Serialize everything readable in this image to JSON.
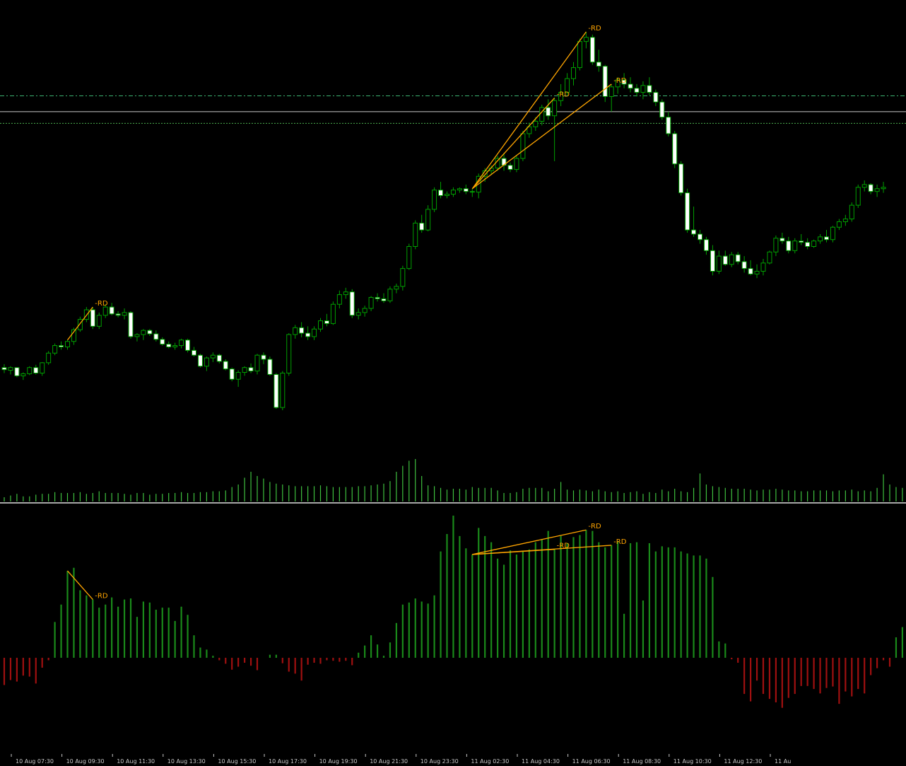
{
  "colors": {
    "background": "#000000",
    "candle_wick": "#00A000",
    "bull_body": "#000000",
    "bear_body": "#FFFFFF",
    "volume": "#3FC03F",
    "hist_positive": "#1A8A1A",
    "hist_negative": "#A01010",
    "divergence": "#FFA500",
    "level_dashdot": "#3CB371",
    "level_dotted": "#4CAF50",
    "level_solid": "#C8C8C8",
    "separator": "#E0E0E0"
  },
  "divergence_label": "-RD",
  "chart_data": [
    {
      "type": "candlestick",
      "description_panel": "price",
      "candles": [
        [
          1.0,
          1.05,
          0.92,
          0.97
        ],
        [
          0.96,
          1.02,
          0.9,
          1.0
        ],
        [
          1.0,
          1.0,
          0.86,
          0.88
        ],
        [
          0.88,
          0.93,
          0.82,
          0.91
        ],
        [
          0.91,
          1.02,
          0.89,
          1.0
        ],
        [
          1.0,
          1.04,
          0.9,
          0.92
        ],
        [
          0.92,
          1.08,
          0.88,
          1.07
        ],
        [
          1.07,
          1.24,
          1.04,
          1.21
        ],
        [
          1.21,
          1.35,
          1.18,
          1.32
        ],
        [
          1.32,
          1.38,
          1.26,
          1.3
        ],
        [
          1.3,
          1.4,
          1.26,
          1.38
        ],
        [
          1.38,
          1.58,
          1.33,
          1.55
        ],
        [
          1.55,
          1.74,
          1.52,
          1.7
        ],
        [
          1.7,
          1.88,
          1.66,
          1.84
        ],
        [
          1.84,
          1.88,
          1.56,
          1.6
        ],
        [
          1.6,
          1.8,
          1.56,
          1.76
        ],
        [
          1.76,
          1.92,
          1.72,
          1.88
        ],
        [
          1.88,
          1.94,
          1.76,
          1.78
        ],
        [
          1.78,
          1.82,
          1.73,
          1.76
        ],
        [
          1.76,
          1.86,
          1.7,
          1.8
        ],
        [
          1.8,
          1.82,
          1.42,
          1.45
        ],
        [
          1.45,
          1.5,
          1.38,
          1.48
        ],
        [
          1.48,
          1.56,
          1.4,
          1.54
        ],
        [
          1.54,
          1.56,
          1.46,
          1.49
        ],
        [
          1.49,
          1.54,
          1.38,
          1.41
        ],
        [
          1.41,
          1.44,
          1.32,
          1.34
        ],
        [
          1.34,
          1.38,
          1.28,
          1.3
        ],
        [
          1.3,
          1.36,
          1.26,
          1.32
        ],
        [
          1.32,
          1.42,
          1.28,
          1.4
        ],
        [
          1.4,
          1.42,
          1.22,
          1.25
        ],
        [
          1.25,
          1.3,
          1.16,
          1.18
        ],
        [
          1.18,
          1.2,
          1.0,
          1.02
        ],
        [
          1.02,
          1.16,
          0.95,
          1.14
        ],
        [
          1.14,
          1.22,
          1.08,
          1.18
        ],
        [
          1.18,
          1.2,
          1.06,
          1.09
        ],
        [
          1.09,
          1.12,
          0.96,
          0.98
        ],
        [
          0.98,
          1.0,
          0.8,
          0.83
        ],
        [
          0.83,
          0.96,
          0.72,
          0.93
        ],
        [
          0.93,
          1.02,
          0.88,
          1.0
        ],
        [
          1.0,
          1.06,
          0.92,
          0.95
        ],
        [
          0.95,
          1.2,
          0.9,
          1.18
        ],
        [
          1.18,
          1.22,
          1.05,
          1.12
        ],
        [
          1.12,
          1.16,
          0.88,
          0.9
        ],
        [
          0.9,
          0.92,
          0.4,
          0.42
        ],
        [
          0.42,
          0.95,
          0.38,
          0.92
        ],
        [
          0.92,
          1.5,
          0.88,
          1.48
        ],
        [
          1.48,
          1.62,
          1.42,
          1.58
        ],
        [
          1.58,
          1.66,
          1.44,
          1.5
        ],
        [
          1.5,
          1.6,
          1.4,
          1.45
        ],
        [
          1.45,
          1.6,
          1.4,
          1.56
        ],
        [
          1.56,
          1.72,
          1.52,
          1.68
        ],
        [
          1.68,
          1.78,
          1.6,
          1.64
        ],
        [
          1.64,
          1.96,
          1.62,
          1.92
        ],
        [
          1.92,
          2.12,
          1.86,
          2.06
        ],
        [
          2.06,
          2.16,
          2.0,
          2.1
        ],
        [
          2.1,
          2.14,
          1.72,
          1.76
        ],
        [
          1.76,
          1.86,
          1.7,
          1.8
        ],
        [
          1.8,
          1.9,
          1.74,
          1.86
        ],
        [
          1.86,
          2.04,
          1.82,
          2.02
        ],
        [
          2.02,
          2.08,
          1.96,
          2.0
        ],
        [
          2.0,
          2.08,
          1.94,
          1.97
        ],
        [
          1.97,
          2.18,
          1.94,
          2.14
        ],
        [
          2.14,
          2.22,
          2.08,
          2.18
        ],
        [
          2.18,
          2.48,
          2.12,
          2.44
        ],
        [
          2.44,
          2.8,
          2.42,
          2.76
        ],
        [
          2.76,
          3.14,
          2.72,
          3.1
        ],
        [
          3.1,
          3.22,
          2.96,
          3.0
        ],
        [
          3.0,
          3.36,
          2.98,
          3.3
        ],
        [
          3.3,
          3.62,
          3.26,
          3.58
        ],
        [
          3.58,
          3.7,
          3.46,
          3.5
        ],
        [
          3.5,
          3.56,
          3.46,
          3.52
        ],
        [
          3.52,
          3.62,
          3.48,
          3.58
        ],
        [
          3.58,
          3.62,
          3.54,
          3.6
        ],
        [
          3.6,
          3.66,
          3.52,
          3.56
        ],
        [
          3.56,
          3.6,
          3.48,
          3.55
        ],
        [
          3.55,
          3.82,
          3.46,
          3.78
        ],
        [
          3.78,
          3.9,
          3.7,
          3.86
        ],
        [
          3.86,
          3.94,
          3.8,
          3.9
        ],
        [
          3.9,
          4.08,
          3.86,
          4.04
        ],
        [
          4.04,
          4.12,
          3.86,
          3.94
        ],
        [
          3.94,
          3.98,
          3.84,
          3.88
        ],
        [
          3.88,
          4.08,
          3.84,
          4.04
        ],
        [
          4.04,
          4.44,
          4.0,
          4.4
        ],
        [
          4.4,
          4.56,
          4.34,
          4.5
        ],
        [
          4.5,
          4.64,
          4.44,
          4.58
        ],
        [
          4.58,
          4.82,
          4.52,
          4.78
        ],
        [
          4.78,
          4.9,
          4.6,
          4.66
        ],
        [
          4.66,
          4.92,
          4.0,
          4.88
        ],
        [
          4.88,
          5.12,
          4.8,
          5.0
        ],
        [
          5.0,
          5.28,
          4.96,
          5.2
        ],
        [
          5.2,
          5.44,
          5.1,
          5.36
        ],
        [
          5.36,
          5.78,
          5.32,
          5.74
        ],
        [
          5.74,
          5.88,
          5.64,
          5.8
        ],
        [
          5.8,
          5.84,
          5.4,
          5.44
        ],
        [
          5.44,
          5.62,
          5.3,
          5.38
        ],
        [
          5.38,
          5.4,
          4.86,
          4.94
        ],
        [
          4.94,
          5.12,
          4.72,
          5.08
        ],
        [
          5.08,
          5.22,
          4.98,
          5.18
        ],
        [
          5.18,
          5.28,
          5.06,
          5.12
        ],
        [
          5.12,
          5.22,
          5.0,
          5.06
        ],
        [
          5.06,
          5.12,
          4.94,
          5.0
        ],
        [
          5.0,
          5.16,
          4.9,
          5.1
        ],
        [
          5.1,
          5.22,
          4.96,
          5.0
        ],
        [
          5.0,
          5.04,
          4.8,
          4.86
        ],
        [
          4.86,
          4.9,
          4.6,
          4.64
        ],
        [
          4.64,
          4.72,
          4.36,
          4.4
        ],
        [
          4.4,
          4.44,
          3.9,
          3.96
        ],
        [
          3.96,
          4.0,
          3.5,
          3.54
        ],
        [
          3.54,
          3.6,
          2.96,
          3.0
        ],
        [
          3.0,
          3.34,
          2.9,
          2.94
        ],
        [
          2.94,
          3.0,
          2.8,
          2.86
        ],
        [
          2.86,
          2.9,
          2.64,
          2.7
        ],
        [
          2.7,
          2.78,
          2.34,
          2.4
        ],
        [
          2.4,
          2.7,
          2.36,
          2.62
        ],
        [
          2.62,
          2.7,
          2.48,
          2.5
        ],
        [
          2.5,
          2.68,
          2.46,
          2.64
        ],
        [
          2.64,
          2.68,
          2.5,
          2.54
        ],
        [
          2.54,
          2.62,
          2.38,
          2.44
        ],
        [
          2.44,
          2.56,
          2.34,
          2.36
        ],
        [
          2.36,
          2.5,
          2.3,
          2.4
        ],
        [
          2.4,
          2.58,
          2.34,
          2.52
        ],
        [
          2.52,
          2.7,
          2.5,
          2.68
        ],
        [
          2.68,
          2.92,
          2.62,
          2.88
        ],
        [
          2.88,
          2.96,
          2.8,
          2.84
        ],
        [
          2.84,
          2.9,
          2.66,
          2.7
        ],
        [
          2.7,
          2.88,
          2.66,
          2.84
        ],
        [
          2.84,
          2.94,
          2.78,
          2.82
        ],
        [
          2.82,
          2.88,
          2.72,
          2.76
        ],
        [
          2.76,
          2.86,
          2.74,
          2.84
        ],
        [
          2.84,
          2.94,
          2.8,
          2.9
        ],
        [
          2.9,
          3.0,
          2.82,
          2.86
        ],
        [
          2.86,
          3.06,
          2.82,
          3.04
        ],
        [
          3.04,
          3.16,
          3.0,
          3.12
        ],
        [
          3.12,
          3.22,
          3.06,
          3.16
        ],
        [
          3.16,
          3.4,
          3.12,
          3.36
        ],
        [
          3.36,
          3.66,
          3.32,
          3.62
        ],
        [
          3.62,
          3.72,
          3.56,
          3.66
        ],
        [
          3.66,
          3.68,
          3.52,
          3.56
        ],
        [
          3.56,
          3.66,
          3.48,
          3.6
        ],
        [
          3.6,
          3.7,
          3.54,
          3.62
        ]
      ],
      "levels": [
        {
          "style": "dashdot",
          "value": 4.95
        },
        {
          "style": "solid",
          "value": 4.72
        },
        {
          "style": "dotted",
          "value": 4.55
        }
      ]
    },
    {
      "type": "bar",
      "description_panel": "volume",
      "values": [
        5,
        7,
        9,
        6,
        6,
        8,
        9,
        9,
        11,
        10,
        10,
        10,
        11,
        9,
        10,
        12,
        10,
        10,
        10,
        9,
        8,
        10,
        10,
        8,
        9,
        9,
        10,
        10,
        11,
        10,
        10,
        11,
        11,
        12,
        12,
        13,
        17,
        20,
        28,
        35,
        30,
        27,
        23,
        21,
        20,
        19,
        18,
        18,
        18,
        18,
        19,
        18,
        17,
        17,
        17,
        17,
        18,
        18,
        19,
        20,
        21,
        24,
        35,
        42,
        48,
        50,
        30,
        19,
        18,
        16,
        14,
        15,
        15,
        14,
        17,
        16,
        16,
        16,
        13,
        10,
        10,
        11,
        15,
        16,
        16,
        16,
        12,
        15,
        23,
        14,
        13,
        14,
        13,
        12,
        14,
        12,
        11,
        12,
        10,
        11,
        12,
        9,
        11,
        10,
        14,
        12,
        15,
        12,
        11,
        16,
        33,
        20,
        18,
        17,
        16,
        15,
        15,
        15,
        14,
        13,
        14,
        14,
        15,
        14,
        13,
        13,
        12,
        12,
        13,
        13,
        13,
        12,
        13,
        13,
        14,
        12,
        13,
        12,
        16,
        32,
        20,
        17,
        16,
        13
      ],
      "ylim": [
        0,
        60
      ]
    },
    {
      "type": "bar",
      "description_panel": "histogram",
      "values": [
        -5.5,
        -4.5,
        -4.8,
        -3.6,
        -3.8,
        -5.2,
        -2.0,
        -0.5,
        3.5,
        5.2,
        8.5,
        8.8,
        6.6,
        6.1,
        5.7,
        4.9,
        5.2,
        5.9,
        5.0,
        5.7,
        5.8,
        4.0,
        5.5,
        5.4,
        4.7,
        4.9,
        4.9,
        3.6,
        5.0,
        4.2,
        2.2,
        1.0,
        0.8,
        0.2,
        -0.5,
        -1.2,
        -2.4,
        -1.8,
        -1.0,
        -1.6,
        -2.5,
        0,
        0.3,
        0.3,
        -1.1,
        -2.8,
        -3.2,
        -4.6,
        -1.4,
        -1.0,
        -1.2,
        -0.5,
        -0.6,
        -0.8,
        -0.6,
        -1.5,
        0.5,
        1.2,
        2.2,
        1.3,
        0.2,
        1.5,
        3.4,
        5.2,
        5.4,
        5.8,
        5.5,
        5.3,
        6.1,
        10.4,
        12.1,
        13.9,
        11.9,
        10.7,
        10.1,
        12.7,
        11.9,
        11.3,
        9.7,
        9.1,
        10.5,
        10.1,
        10.4,
        10.6,
        11.3,
        11.6,
        12.4,
        10.6,
        11.9,
        11.2,
        11.8,
        12.0,
        12.5,
        12.4,
        11.3,
        10.8,
        11.0,
        11.4,
        4.3,
        11.2,
        11.3,
        5.6,
        11.2,
        10.4,
        10.9,
        10.8,
        10.8,
        10.4,
        10.2,
        10.0,
        10.0,
        9.7,
        7.9,
        1.6,
        1.4,
        -0.3,
        -1.0,
        -7.3,
        -8.8,
        -4.6,
        -7.3,
        -8.3,
        -9.0,
        -10.1,
        -8.1,
        -7.3,
        -5.7,
        -5.7,
        -6.3,
        -7.2,
        -6.1,
        -5.8,
        -9.3,
        -6.8,
        -7.8,
        -6.3,
        -7.2,
        -3.5,
        -2.1,
        -0.5,
        -1.8,
        2.0,
        3.0
      ],
      "ylim": [
        -10,
        13
      ]
    }
  ],
  "divergences": [
    {
      "panel": "price",
      "from": 10,
      "to": 14,
      "label_at": 14
    },
    {
      "panel": "price",
      "from": 74,
      "to": 87,
      "label_at": 87
    },
    {
      "panel": "price",
      "from": 74,
      "to": 92,
      "label_at": 92
    },
    {
      "panel": "price",
      "from": 74,
      "to": 96,
      "label_at": 96
    },
    {
      "panel": "histogram",
      "from": 10,
      "to": 14,
      "label_at": 14
    },
    {
      "panel": "histogram",
      "from": 74,
      "to": 87,
      "label_at": 87
    },
    {
      "panel": "histogram",
      "from": 74,
      "to": 92,
      "label_at": 92
    },
    {
      "panel": "histogram",
      "from": 74,
      "to": 96,
      "label_at": 96
    }
  ],
  "xaxis": {
    "tick_labels": [
      "10 Aug 07:30",
      "10 Aug 09:30",
      "10 Aug 11:30",
      "10 Aug 13:30",
      "10 Aug 15:30",
      "10 Aug 17:30",
      "10 Aug 19:30",
      "10 Aug 21:30",
      "10 Aug 23:30",
      "11 Aug 02:30",
      "11 Aug 04:30",
      "11 Aug 06:30",
      "11 Aug 08:30",
      "11 Aug 10:30",
      "11 Aug 12:30",
      "11 Au"
    ],
    "tick_index_step": 8
  }
}
